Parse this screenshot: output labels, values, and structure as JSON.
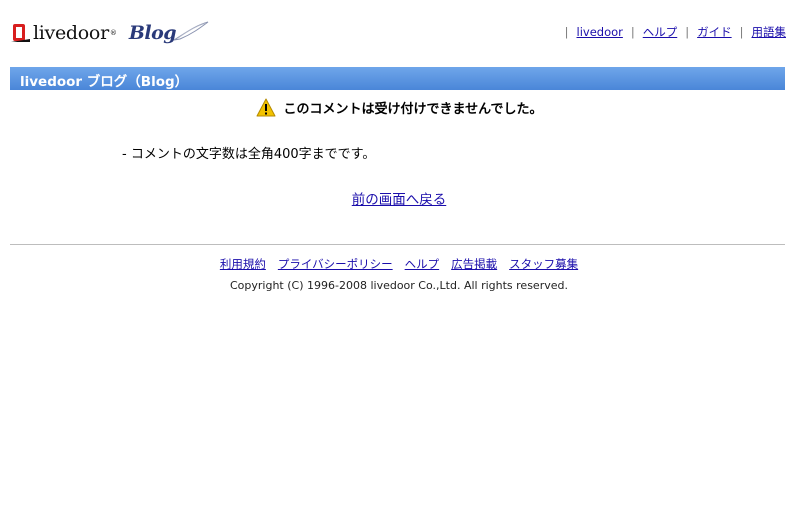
{
  "header": {
    "logo_text": "livedoor",
    "logo_reg": "®",
    "logo_blog": "Blog",
    "nav": [
      {
        "label": "livedoor"
      },
      {
        "label": "ヘルプ"
      },
      {
        "label": "ガイド"
      },
      {
        "label": "用語集"
      }
    ]
  },
  "titlebar": {
    "title": "livedoor ブログ（Blog）"
  },
  "message": {
    "text": "このコメントは受け付けできませんでした。"
  },
  "detail": {
    "text": "- コメントの文字数は全角400字までです。"
  },
  "back": {
    "label": "前の画面へ戻る"
  },
  "footer": {
    "links": [
      {
        "label": "利用規約"
      },
      {
        "label": "プライバシーポリシー"
      },
      {
        "label": "ヘルプ"
      },
      {
        "label": "広告掲載"
      },
      {
        "label": "スタッフ募集"
      }
    ],
    "copyright": "Copyright (C) 1996-2008 livedoor Co.,Ltd. All rights reserved."
  },
  "colors": {
    "titlebar": "#5a94e0",
    "link": "#1a0dab",
    "warning": "#f2c200"
  }
}
